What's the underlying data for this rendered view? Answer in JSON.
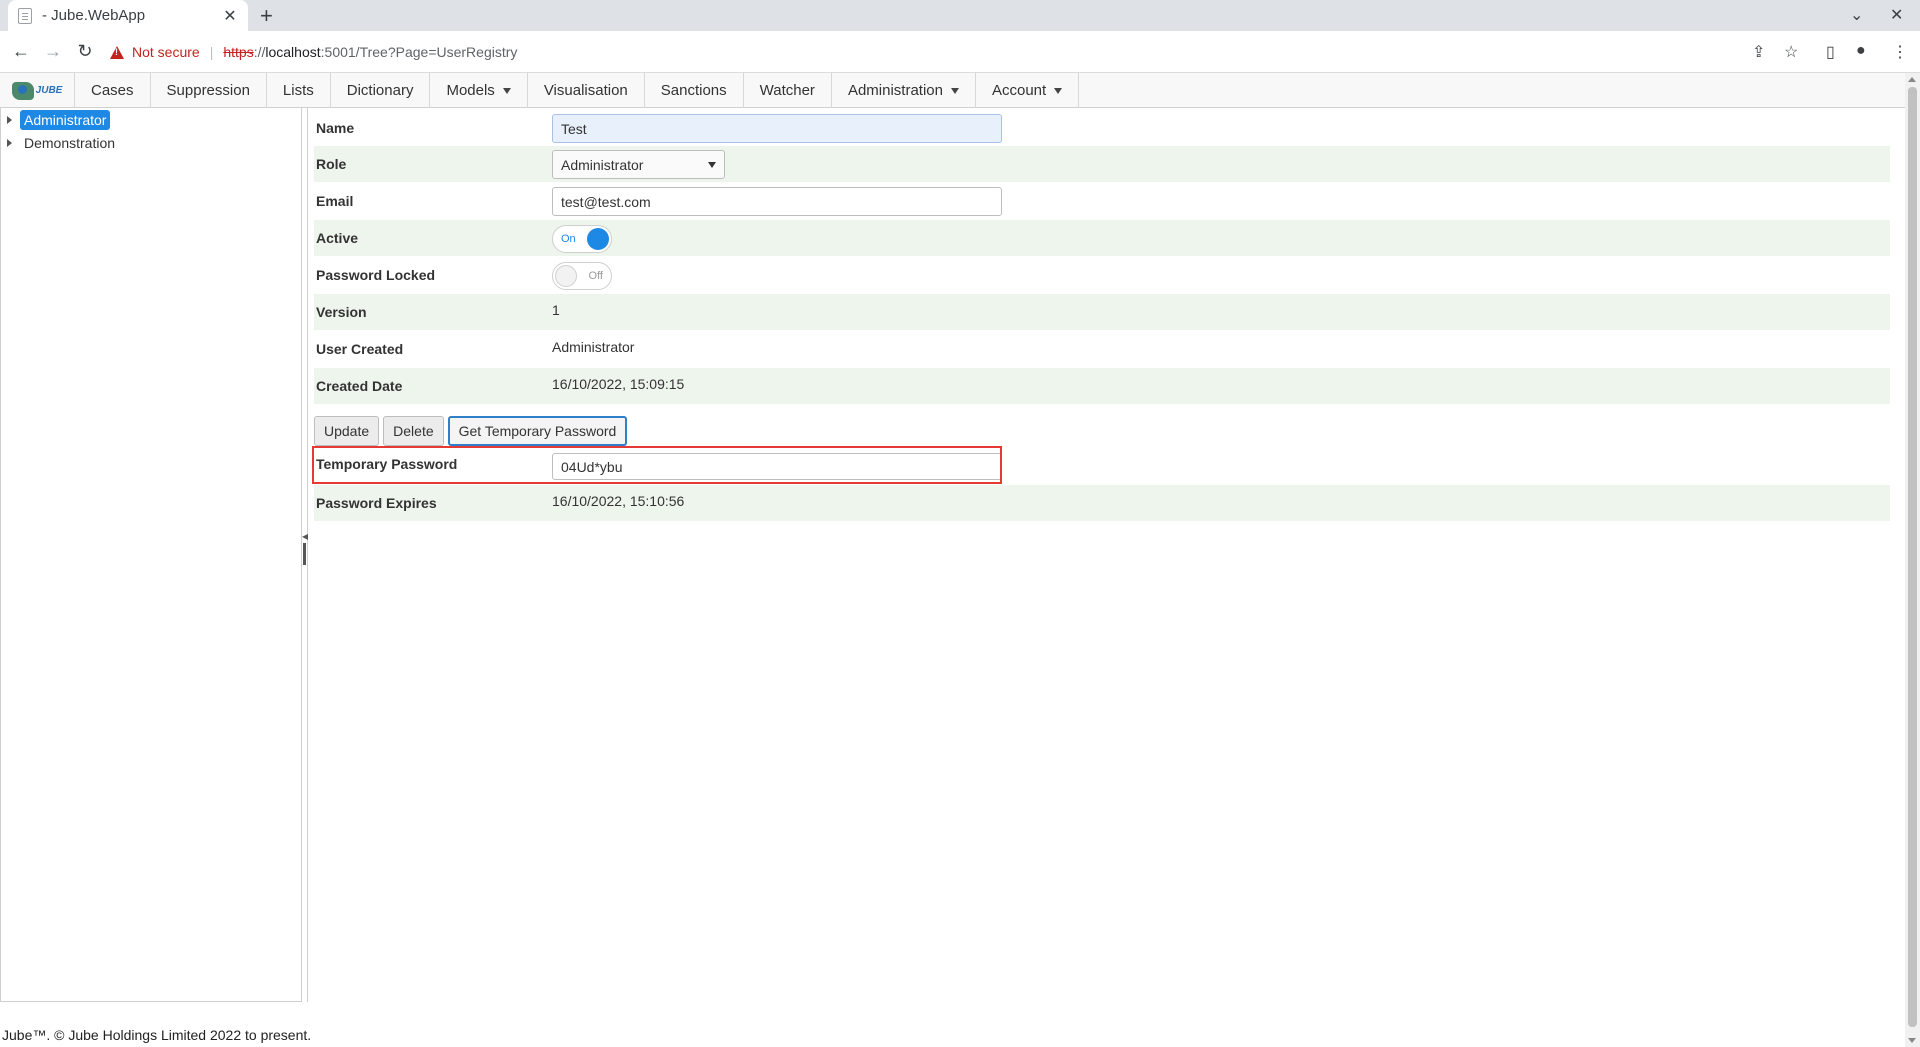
{
  "browser": {
    "tab_title": "- Jube.WebApp",
    "tab_close": "✕",
    "new_tab": "+",
    "minimize": "⌄",
    "close": "✕",
    "not_secure": "Not secure",
    "url_scheme": "https",
    "url_sep": "://",
    "url_host": "localhost",
    "url_path": ":5001/Tree?Page=UserRegistry"
  },
  "nav": {
    "logo_text": "JUBE",
    "items": [
      {
        "label": "Cases",
        "dropdown": false
      },
      {
        "label": "Suppression",
        "dropdown": false
      },
      {
        "label": "Lists",
        "dropdown": false
      },
      {
        "label": "Dictionary",
        "dropdown": false
      },
      {
        "label": "Models",
        "dropdown": true
      },
      {
        "label": "Visualisation",
        "dropdown": false
      },
      {
        "label": "Sanctions",
        "dropdown": false
      },
      {
        "label": "Watcher",
        "dropdown": false
      },
      {
        "label": "Administration",
        "dropdown": true
      },
      {
        "label": "Account",
        "dropdown": true
      }
    ]
  },
  "tree": {
    "nodes": [
      {
        "label": "Administrator",
        "selected": true
      },
      {
        "label": "Demonstration",
        "selected": false
      }
    ]
  },
  "form": {
    "name_label": "Name",
    "name_value": "Test",
    "role_label": "Role",
    "role_value": "Administrator",
    "email_label": "Email",
    "email_value": "test@test.com",
    "active_label": "Active",
    "active_state": "On",
    "password_locked_label": "Password Locked",
    "password_locked_state": "Off",
    "version_label": "Version",
    "version_value": "1",
    "user_created_label": "User Created",
    "user_created_value": "Administrator",
    "created_date_label": "Created Date",
    "created_date_value": "16/10/2022, 15:09:15"
  },
  "actions": {
    "update": "Update",
    "delete": "Delete",
    "get_temp_password": "Get Temporary Password"
  },
  "temp": {
    "temp_password_label": "Temporary Password",
    "temp_password_value": "04Ud*ybu",
    "password_expires_label": "Password Expires",
    "password_expires_value": "16/10/2022, 15:10:56"
  },
  "footer": {
    "text": "Jube™. © Jube Holdings Limited 2022 to present."
  }
}
